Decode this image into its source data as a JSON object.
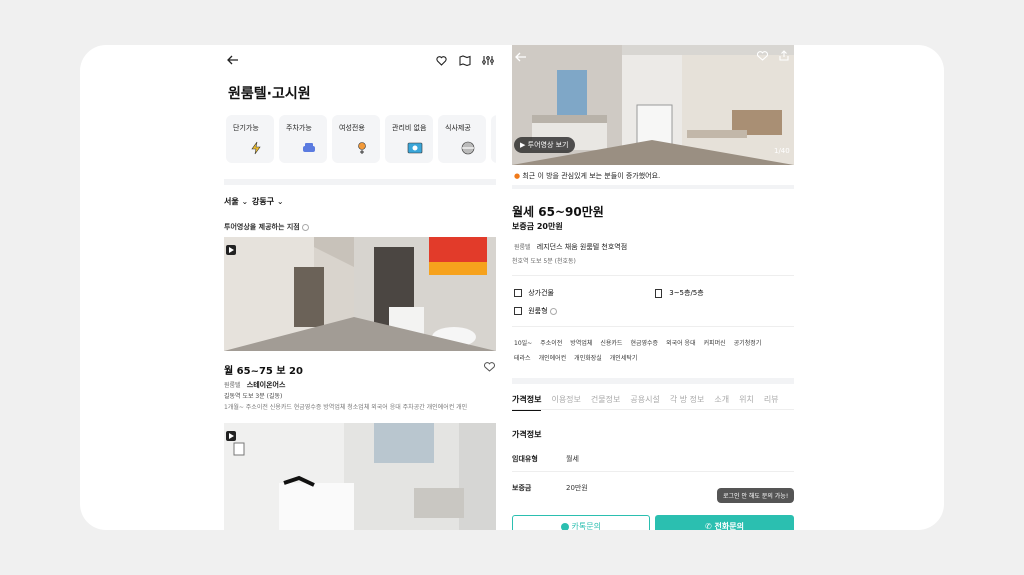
{
  "left": {
    "title": "원룸텔·고시원",
    "categories": [
      {
        "label": "단기가능",
        "icon": "lightning-icon"
      },
      {
        "label": "주차가능",
        "icon": "car-icon"
      },
      {
        "label": "여성전용",
        "icon": "female-icon"
      },
      {
        "label": "관리비 없음",
        "icon": "bill-icon"
      },
      {
        "label": "식사제공",
        "icon": "meal-icon"
      }
    ],
    "region": "서울",
    "district": "강동구",
    "section_title": "투어영상을 제공하는 지점",
    "listing1": {
      "price": "월 65~75  보 20",
      "type": "원룸텔",
      "name": "스테이온어스",
      "location": "길동역 도보 3분 (길동)",
      "tags": "1개월~  주소이전  신용카드  현금영수증  방역업체  청소업체  외국어 응대  주차공간  개인에어컨  개인"
    }
  },
  "right": {
    "photo_counter": "1/40",
    "tour_button": "투어영상 보기",
    "notice": "최근 이 방을 관심있게 보는 분들이 증가했어요.",
    "price": "월세 65~90만원",
    "deposit": "보증금 20만원",
    "type": "원룸텔",
    "name": "레지던스 채움 원룸텔 천호역점",
    "location": "천호역 도보 5분 (천호동)",
    "building_type": "상가건물",
    "floor": "3~5층/5층",
    "room_type": "원룸형",
    "tags_row1": [
      "10일~",
      "주소이전",
      "방역업체",
      "신용카드",
      "현금영수증",
      "외국어 응대",
      "커피머신",
      "공기청정기"
    ],
    "tags_row2": [
      "테라스",
      "개인에어컨",
      "개인화장실",
      "개인세탁기"
    ],
    "tabs": [
      "가격정보",
      "이용정보",
      "건물정보",
      "공용시설",
      "각 방 정보",
      "소개",
      "위치",
      "리뷰"
    ],
    "price_section_title": "가격정보",
    "rent_type_label": "임대유형",
    "rent_type_value": "월세",
    "deposit_label": "보증금",
    "deposit_value": "20만원",
    "tooltip": "로그인 안 해도 문의 가능!",
    "chat_button": "카톡문의",
    "call_button": "전화문의",
    "accent_color": "#2bbfb0"
  }
}
